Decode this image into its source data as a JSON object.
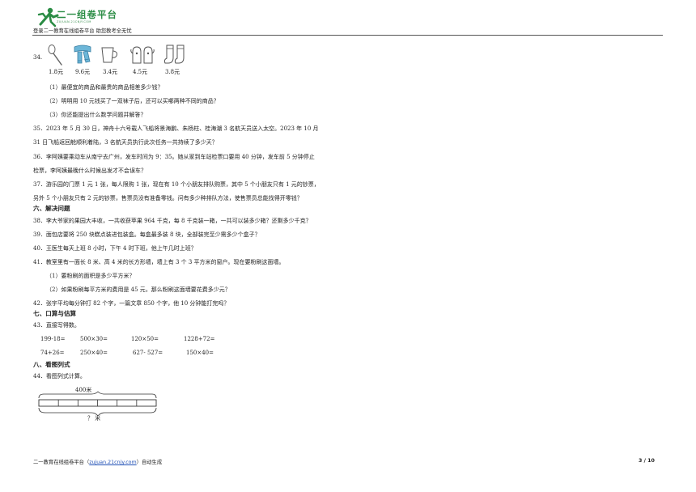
{
  "header": {
    "logo_text": "二一组卷平台",
    "logo_sub": "ZUJUAN.21CNJY.COM",
    "tagline": "登录二一教育在线组卷平台 助您教考全无忧"
  },
  "q34": {
    "number": "34.",
    "items": [
      {
        "icon": "spoon-icon",
        "price": "1.8元"
      },
      {
        "icon": "scarf-icon",
        "price": "9.6元"
      },
      {
        "icon": "cup-icon",
        "price": "3.4元"
      },
      {
        "icon": "gloves-icon",
        "price": "4.5元"
      },
      {
        "icon": "socks-icon",
        "price": "3.8元"
      }
    ],
    "sub1": "（1）最便宜的商品和最贵的商品相差多少钱？",
    "sub2": "（2）明明用 10 元钱买了一双袜子后，还可以买哪两种不同的商品？",
    "sub3": "（3）你还能提出什么数学问题并解答？"
  },
  "q35": {
    "line1": "35．2023 年 5 月 30 日，神舟十六号载人飞船将景海鹏、朱杨柱、桂海潮 3 名航天员送入太空。2023 年 10 月",
    "line2": "31 日飞船返回舱顺利着陆，3 名航天员执行此次任务一共持续了多少天？"
  },
  "q36": {
    "line1": "36．李阿姨要乘动车从南宁去广州，发车时间为 9：35。她从家到车站检票口要用 40 分钟，发车前 5 分钟停止",
    "line2": "检票，李阿姨最晚什么时候出发才不会误车？"
  },
  "q37": {
    "line1": "37．游乐园的门票 1 元 1 张，每人限购 1 张，现在有 10 个小朋友排队购票，其中 5 个小朋友只有 1 元的钞票，",
    "line2": "另外 5 个小朋友只有 2 元的钞票，售票员没有准备零钱。问有多少种排队方法，使售票员总能找得开零钱？"
  },
  "sections": {
    "six": "六、解决问题",
    "seven": "七、口算与估算",
    "eight": "八、看图列式"
  },
  "q38": "38．李大爷家的果园大丰收，一共收获苹果 964 千克，每 8 千克装一箱，一共可以装多少箱？还剩多少千克？",
  "q39": "39．面包店要将 250 块糕点装进包装盒。每盒最多装 8 块，全部装完至少需多少个盒子？",
  "q40": "40．王医生每天上班 8 小时，下午 4 时下班，他上午几时上班？",
  "q41": {
    "stem": "41．教室里有一面长 8 米、高 4 米的长方形墙，墙上有 3 个 3 平方米的窗户。现在要粉刷这面墙。",
    "sub1": "（1）要粉刷的面积是多少平方米？",
    "sub2": "（2）如果粉刷每平方米的费用是 45 元，那么粉刷这面墙要花费多少元？"
  },
  "q42": "42．张宇平均每分钟打 82 个字，一篇文章 850 个字，他 10 分钟能打完吗？",
  "q43": {
    "stem": "43．直接写得数。",
    "row1": [
      "199-18=",
      "500×30=",
      "120×50=",
      "1228+72="
    ],
    "row2": [
      "74+26=",
      "250×40=",
      "627- 527=",
      "150×40="
    ]
  },
  "q44": {
    "stem": "44．看图列式计算。",
    "top_label": "400米",
    "bottom_label": "？ 米",
    "segments": 6
  },
  "footer": {
    "left": "二一教育在线组卷平台（",
    "link": "zujuan.21cnjy.com",
    "right": "）自动生成",
    "page": "3 / 10"
  }
}
